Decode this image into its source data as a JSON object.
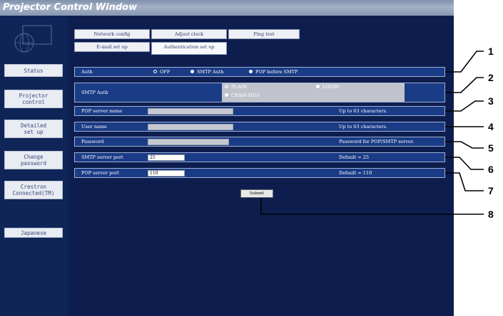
{
  "window": {
    "title": "Projector Control Window"
  },
  "sidebar": {
    "items": [
      {
        "label": "Status"
      },
      {
        "label": "Projector\ncontrol"
      },
      {
        "label": "Detailed\nset up"
      },
      {
        "label": "Change\npassword"
      },
      {
        "label": "Crestron\nConnected(TM)"
      },
      {
        "label": "Japanese"
      }
    ]
  },
  "tabs": [
    {
      "label": "Network config"
    },
    {
      "label": "Adjust clock"
    },
    {
      "label": "Ping test"
    },
    {
      "label": "E-mail set up"
    },
    {
      "label": "Authentication set up"
    }
  ],
  "form": {
    "auth": {
      "label": "Auth",
      "options": [
        "OFF",
        "SMTP Auth",
        "POP before SMTP"
      ],
      "selected": "OFF"
    },
    "smtp_auth": {
      "label": "SMTP Auth",
      "options": [
        "PLAIN",
        "LOGIN",
        "CRAM-MD5"
      ],
      "selected": "PLAIN"
    },
    "pop_server_name": {
      "label": "POP server name",
      "value": "",
      "note": "Up to 63 characters."
    },
    "user_name": {
      "label": "User name",
      "value": "",
      "note": "Up to 63 characters."
    },
    "password": {
      "label": "Password",
      "value": "",
      "note": "Password for POP/SMTP server."
    },
    "smtp_server_port": {
      "label": "SMTP server port",
      "value": "25",
      "note": "Default = 25"
    },
    "pop_server_port": {
      "label": "POP server port",
      "value": "110",
      "note": "Default = 110"
    }
  },
  "submit_label": "Submit",
  "callouts": [
    "1",
    "2",
    "3",
    "4",
    "5",
    "6",
    "7",
    "8"
  ]
}
